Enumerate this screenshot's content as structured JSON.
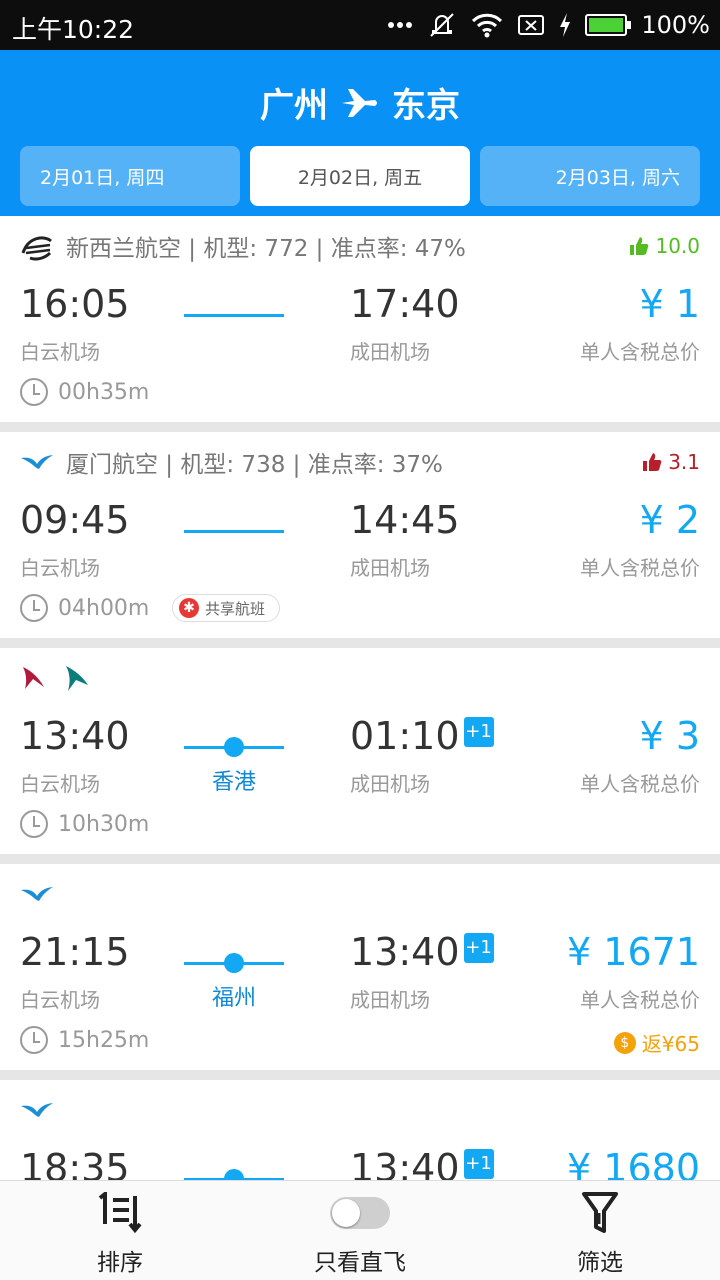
{
  "status": {
    "time": "上午10:22",
    "battery_pct": "100%"
  },
  "header": {
    "from": "广州",
    "to": "东京",
    "dates": [
      "2月01日, 周四",
      "2月02日, 周五",
      "2月03日, 周六"
    ],
    "selected_index": 1
  },
  "flights": [
    {
      "airline": "新西兰航空 | 机型: 772 | 准点率: 47%",
      "rating": "10.0",
      "rating_type": "good",
      "dep_time": "16:05",
      "dep_airport": "白云机场",
      "arr_time": "17:40",
      "arr_airport": "成田机场",
      "price": "¥ 1",
      "price_label": "单人含税总价",
      "duration": "00h35m"
    },
    {
      "airline": "厦门航空 | 机型: 738 | 准点率: 37%",
      "rating": "3.1",
      "rating_type": "bad",
      "dep_time": "09:45",
      "dep_airport": "白云机场",
      "arr_time": "14:45",
      "arr_airport": "成田机场",
      "price": "¥ 2",
      "price_label": "单人含税总价",
      "duration": "04h00m",
      "badge": "共享航班"
    },
    {
      "dep_time": "13:40",
      "dep_airport": "白云机场",
      "arr_time": "01:10",
      "arr_plus": "+1",
      "arr_airport": "成田机场",
      "stop": "香港",
      "price": "¥ 3",
      "price_label": "单人含税总价",
      "duration": "10h30m"
    },
    {
      "dep_time": "21:15",
      "dep_airport": "白云机场",
      "arr_time": "13:40",
      "arr_plus": "+1",
      "arr_airport": "成田机场",
      "stop": "福州",
      "price": "¥ 1671",
      "price_label": "单人含税总价",
      "duration": "15h25m",
      "rebate": "返¥65"
    },
    {
      "dep_time": "18:35",
      "arr_time": "13:40",
      "arr_plus": "+1",
      "price": "¥ 1680"
    }
  ],
  "bottom": {
    "sort": "排序",
    "direct_only": "只看直飞",
    "filter": "筛选"
  },
  "colors": {
    "accent": "#0a91f5",
    "price": "#12a8f3",
    "good": "#55bb22",
    "bad": "#b6202d",
    "rebate": "#f3a20c"
  }
}
